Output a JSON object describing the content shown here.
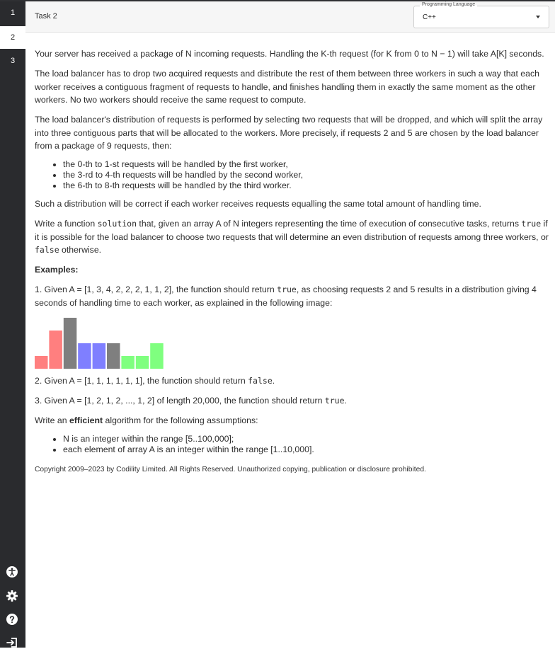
{
  "sidebar": {
    "tasks": [
      "1",
      "2",
      "3"
    ],
    "active_index": 1,
    "icons": [
      "accessibility-icon",
      "settings-icon",
      "help-icon",
      "logout-icon"
    ]
  },
  "header": {
    "task_title": "Task 2",
    "language_label": "Programming Language",
    "language_value": "C++"
  },
  "content": {
    "p1": "Your server has received a package of N incoming requests. Handling the K-th request (for K from 0 to N − 1) will take A[K] seconds.",
    "p2": "The load balancer has to drop two acquired requests and distribute the rest of them between three workers in such a way that each worker receives a contiguous fragment of requests to handle, and finishes handling them in exactly the same moment as the other workers. No two workers should receive the same request to compute.",
    "p3": "The load balancer's distribution of requests is performed by selecting two requests that will be dropped, and which will split the array into three contiguous parts that will be allocated to the workers. More precisely, if requests 2 and 5 are chosen by the load balancer from a package of 9 requests, then:",
    "list1": [
      "the 0-th to 1-st requests will be handled by the first worker,",
      "the 3-rd to 4-th requests will be handled by the second worker,",
      "the 6-th to 8-th requests will be handled by the third worker."
    ],
    "p4": "Such a distribution will be correct if each worker receives requests equalling the same total amount of handling time.",
    "p5": {
      "a": "Write a function ",
      "code1": "solution",
      "b": " that, given an array A of N integers representing the time of execution of consecutive tasks, returns ",
      "code2": "true",
      "c": " if it is possible for the load balancer to choose two requests that will determine an even distribution of requests among three workers, or ",
      "code3": "false",
      "d": " otherwise."
    },
    "examples_heading": "Examples:",
    "ex1": {
      "a": "1. Given A = [1, 3, 4, 2, 2, 2, 1, 1, 2], the function should return ",
      "code": "true",
      "b": ", as choosing requests 2 and 5 results in a distribution giving 4 seconds of handling time to each worker, as explained in the following image:"
    },
    "ex2": {
      "a": "2. Given A = [1, 1, 1, 1, 1, 1], the function should return ",
      "code": "false",
      "b": "."
    },
    "ex3": {
      "a": "3. Given A = [1, 2, 1, 2, ..., 1, 2] of length 20,000, the function should return ",
      "code": "true",
      "b": "."
    },
    "p6": {
      "a": "Write an ",
      "strong": "efficient",
      "b": " algorithm for the following assumptions:"
    },
    "list2": [
      "N is an integer within the range [5..100,000];",
      "each element of array A is an integer within the range [1..10,000]."
    ],
    "copyright": "Copyright 2009–2023 by Codility Limited. All Rights Reserved. Unauthorized copying, publication or disclosure prohibited."
  },
  "chart_data": {
    "type": "bar",
    "values": [
      1,
      3,
      4,
      2,
      2,
      2,
      1,
      1,
      2
    ],
    "groups": [
      "worker1",
      "worker1",
      "dropped",
      "worker2",
      "worker2",
      "dropped",
      "worker3",
      "worker3",
      "worker3"
    ],
    "colors": {
      "worker1": "#ff7f7f",
      "dropped": "#7f7f7f",
      "worker2": "#7f7fff",
      "worker3": "#7fff7f"
    },
    "ylim": [
      0,
      4
    ],
    "grid": false
  }
}
